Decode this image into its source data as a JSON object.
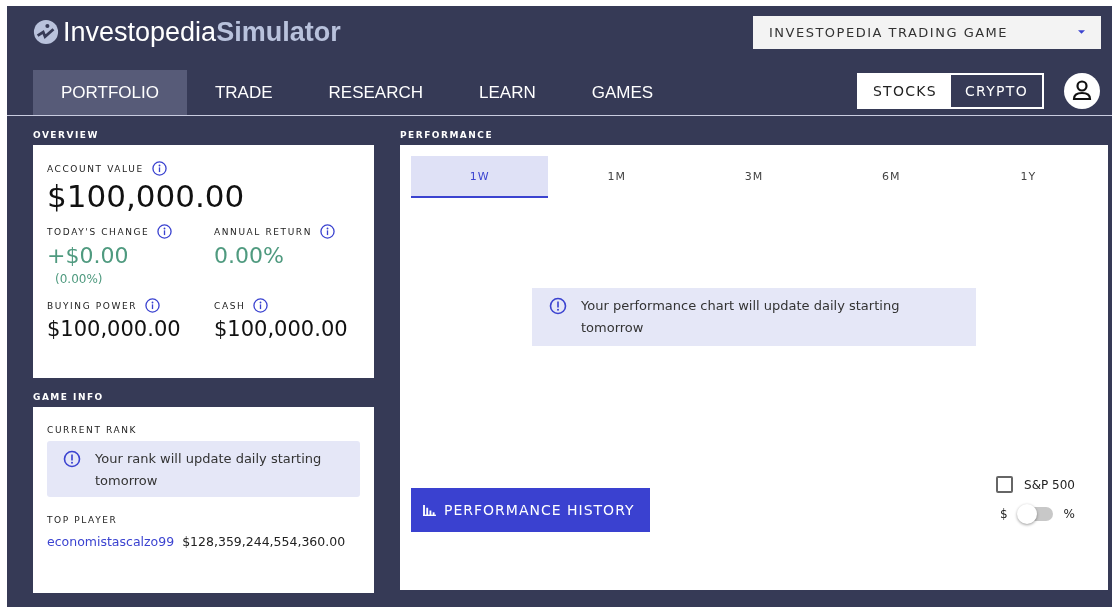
{
  "logo": {
    "brand": "Investopedia",
    "product": "Simulator"
  },
  "game_select": {
    "value": "INVESTOPEDIA TRADING GAME"
  },
  "nav": [
    {
      "label": "PORTFOLIO",
      "selected": true
    },
    {
      "label": "TRADE",
      "selected": false
    },
    {
      "label": "RESEARCH",
      "selected": false
    },
    {
      "label": "LEARN",
      "selected": false
    },
    {
      "label": "GAMES",
      "selected": false
    }
  ],
  "asset_tabs": [
    {
      "label": "STOCKS",
      "selected": true
    },
    {
      "label": "CRYPTO",
      "selected": false
    }
  ],
  "overview": {
    "title": "OVERVIEW",
    "account_value_label": "ACCOUNT VALUE",
    "account_value": "$100,000.00",
    "todays_change_label": "TODAY'S CHANGE",
    "todays_change": "+$0.00",
    "todays_change_pct": "(0.00%)",
    "annual_return_label": "ANNUAL RETURN",
    "annual_return": "0.00%",
    "buying_power_label": "BUYING POWER",
    "buying_power": "$100,000.00",
    "cash_label": "CASH",
    "cash": "$100,000.00"
  },
  "game_info": {
    "title": "GAME INFO",
    "current_rank_label": "CURRENT RANK",
    "rank_notice": "Your rank will update daily starting tomorrow",
    "top_player_label": "TOP PLAYER",
    "top_player": "economistascalzo99",
    "top_player_value": "$128,359,244,554,360.00"
  },
  "performance": {
    "title": "PERFORMANCE",
    "ranges": [
      {
        "label": "1W",
        "selected": true
      },
      {
        "label": "1M",
        "selected": false
      },
      {
        "label": "3M",
        "selected": false
      },
      {
        "label": "6M",
        "selected": false
      },
      {
        "label": "1Y",
        "selected": false
      }
    ],
    "notice": "Your performance chart will update daily starting tomorrow",
    "history_button": "PERFORMANCE HISTORY",
    "benchmark": {
      "label": "S&P 500",
      "checked": false
    },
    "toggle": {
      "left": "$",
      "right": "%",
      "on": false
    }
  }
}
